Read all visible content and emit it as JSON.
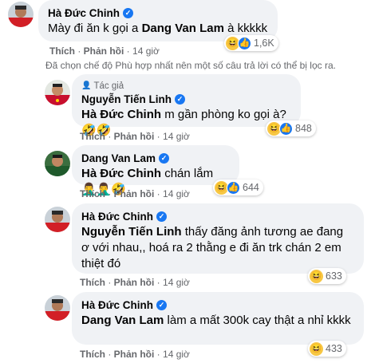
{
  "comments": [
    {
      "author": "Hà Đức Chinh",
      "mention": "Dang Van Lam",
      "before": "Mày đi ăn k gọi a ",
      "after": " à kkkkk",
      "like_label": "Thích",
      "reply_label": "Phản hồi",
      "time": "14 giờ",
      "reactions": "1,6K"
    },
    {
      "author_tag": "Tác giả",
      "author": "Nguyễn Tiến Linh",
      "mention": "Hà Đức Chinh",
      "after": " m gần phòng ko gọi à?🤣🤣",
      "like_label": "Thích",
      "reply_label": "Phản hồi",
      "time": "14 giờ",
      "reactions": "848"
    },
    {
      "author": "Dang Van Lam",
      "mention": "Hà Đức Chinh",
      "after": " chán lắm 🤦‍♂️🤦‍♂️🤣",
      "like_label": "Thích",
      "reply_label": "Phản hồi",
      "time": "14 giờ",
      "reactions": "644"
    },
    {
      "author": "Hà Đức Chinh",
      "mention": "Nguyễn Tiến Linh",
      "after": " thấy đăng ảnh tương ae đang ơ với nhau,, hoá ra 2 thằng e đi ăn trk chán 2 em thiệt đó",
      "like_label": "Thích",
      "reply_label": "Phản hồi",
      "time": "14 giờ",
      "reactions": "633"
    },
    {
      "author": "Hà Đức Chinh",
      "mention": "Dang Van Lam",
      "after": " làm a mất 300k cay thật a nhỉ kkkk",
      "like_label": "Thích",
      "reply_label": "Phản hồi",
      "time": "14 giờ",
      "reactions": "433"
    }
  ],
  "filter_note": "Đã chọn chế độ Phù hợp nhất nên một số câu trả lời có thể bị lọc ra.",
  "separator": " · ",
  "icons": {
    "verified": "verified-badge-icon",
    "haha": "haha-reaction-icon",
    "like": "like-reaction-icon",
    "author": "author-badge-icon"
  },
  "colors": {
    "bubble": "#f0f2f5",
    "meta": "#65676b",
    "verified": "#1877f2",
    "haha": "#f7c744"
  }
}
